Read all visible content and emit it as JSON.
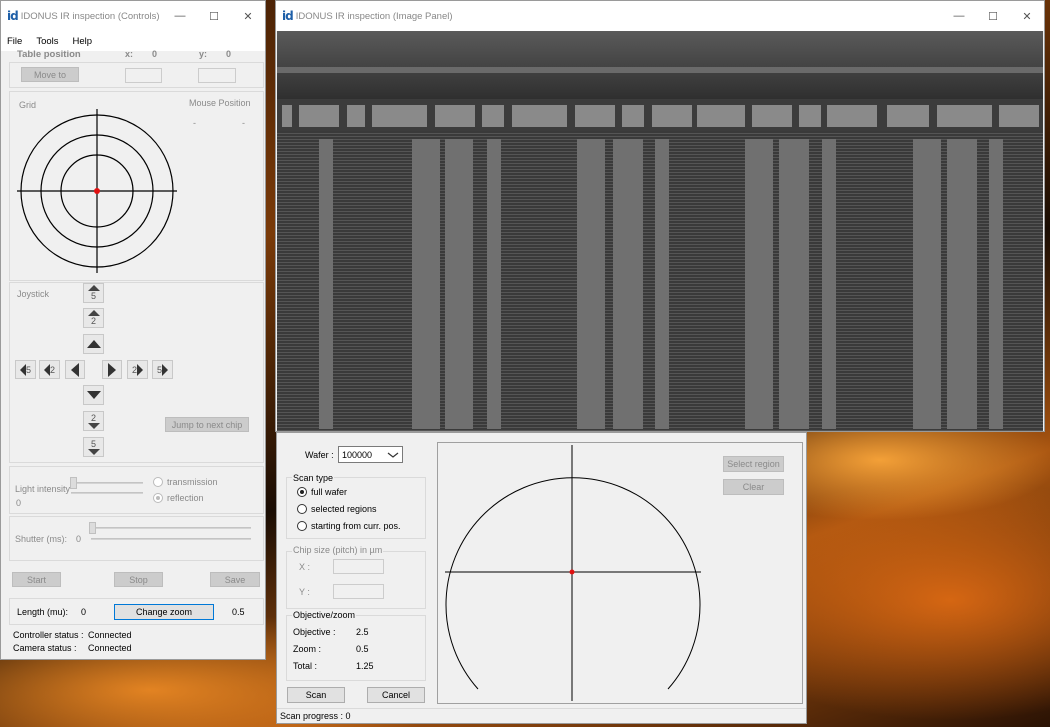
{
  "controls_window": {
    "title": "IDONUS IR inspection (Controls)",
    "logo": "id",
    "menu": [
      "File",
      "Tools",
      "Help"
    ],
    "table_position": {
      "label": "Table position",
      "x_label": "x:",
      "x_value": "0",
      "y_label": "y:",
      "y_value": "0",
      "move_button": "Move to"
    },
    "grid": {
      "label": "Grid",
      "mouse_position_label": "Mouse Position",
      "mouse_x": "-",
      "mouse_y": "-"
    },
    "joystick": {
      "label": "Joystick",
      "up_5": "5",
      "up_2": "2",
      "down_2": "2",
      "down_5": "5",
      "left_5": "5",
      "left_2": "2",
      "right_2": "2",
      "right_5": "5",
      "jump_button": "Jump to next chip"
    },
    "light": {
      "label": "Light intensity",
      "value": "0",
      "transmission": "transmission",
      "reflection": "reflection"
    },
    "shutter": {
      "label": "Shutter (ms):",
      "value": "0"
    },
    "actions": {
      "start": "Start",
      "stop": "Stop",
      "save": "Save"
    },
    "zoom": {
      "length_label": "Length (mu):",
      "length_value": "0",
      "change_zoom_button": "Change zoom",
      "zoom_value": "0.5"
    },
    "status": {
      "controller_label": "Controller status :",
      "controller_value": "Connected",
      "camera_label": "Camera status :",
      "camera_value": "Connected"
    }
  },
  "image_window": {
    "title": "IDONUS IR inspection (Image Panel)",
    "logo": "id"
  },
  "scan_panel": {
    "wafer_label": "Wafer :",
    "wafer_value": "100000",
    "scan_type": {
      "label": "Scan type",
      "options": [
        "full wafer",
        "selected regions",
        "starting from curr. pos."
      ],
      "selected": 0
    },
    "chip_size": {
      "label": "Chip size (pitch) in µm",
      "x_label": "X :",
      "y_label": "Y :"
    },
    "objective_zoom": {
      "label": "Objective/zoom",
      "objective_label": "Objective :",
      "objective_value": "2.5",
      "zoom_label": "Zoom :",
      "zoom_value": "0.5",
      "total_label": "Total :",
      "total_value": "1.25"
    },
    "scan_button": "Scan",
    "cancel_button": "Cancel",
    "select_region_button": "Select region",
    "clear_button": "Clear",
    "scan_progress": "Scan progress :  0"
  },
  "colors": {
    "accent_logo": "#1e5fa8",
    "marker": "#e01010"
  }
}
